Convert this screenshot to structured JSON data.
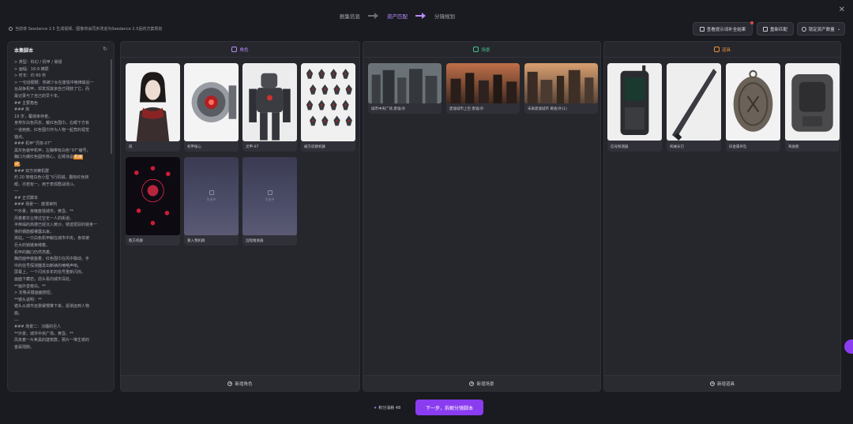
{
  "steps": [
    "剧集信息",
    "资产匹配",
    "分镜规划"
  ],
  "notice": "当前将 Seedance 2.5 生成视频，图像将会同步改进为Seedance 2.5后的方案规划",
  "toolbar": {
    "hint_btn": "查看提示词补全结果",
    "rematch_btn": "重新匹配",
    "lock_btn": "锁定资产数量"
  },
  "script_panel": {
    "title": "本集脚本",
    "lines": [
      "> 类型：科幻 / 机甲 / 悬疑",
      "> 画幅：16:9 横屏",
      "> 时长：约 60 秒",
      "> 一句话梗概：热被少女在废墟中晚律最后一",
      "台战争机甲，却发现其亲自己残骸了它，而",
      "最记录与了自己的早十年。",
      "## 主要角色",
      "### 岚",
      "19 岁，覆城幸存者。",
      "身穿灰白色风衣，戴红色围巾，右眼下方有",
      "一道疤痕。红色围巾作为人物一起竟的视觉",
      "锚点。",
      "### 机甲“灵核-07”",
      "黑灰色装甲机甲，左胸带有白色“07”编号，",
      "胸口为爆红色圆形核心，右臂液晶[机械]",
      "[武]。",
      "### 双方侦察机群",
      "约 20 架暗白色小型飞行机械，翻有红色核",
      "眼，亦若有一。用于表现群战场斗。",
      "---",
      "## 正式脚本",
      "### 场景一：废墟审判",
      "**外景，夜晚废墟城市，黄昏。**",
      "风卷着灰尘穿过空无一人的街道。",
      "半倒塌的高楼已经沉入黄沙，锈迹斑驳的镜身一",
      "排的钢筋都裸露出来。",
      "岚站，一只白色机甲躺在城市中央，身体被",
      "巨大的锁链束缚着。",
      "机甲的胸口仍然亮着。",
      "胸前面甲装盔着，红色围巾在风中飘动。手",
      "中的信号探测器发出断续的嘀嗒声响。",
      "屏幕上，一个闪烁多年的信号重新闪烁。",
      "画面下藏岩，前头看向城市深处。",
      "**画外音旁白。**",
      "> 定格关键画面按钮。",
      "**镜头说明：**",
      "镜头从城市远景缓慢推下来，逐渐远到人物",
      "面。",
      "---",
      "### 场景二：沉睡的巨人",
      "**外景，城市中央广场，黄昏。**",
      "风夹着一片焦黑的建筑群，那片一堆生锈的",
      "金属残骸。"
    ]
  },
  "columns": [
    {
      "label": "角色",
      "color": "#b98bff",
      "add_label": "新增角色",
      "cards": [
        {
          "caption": "岚",
          "kind": "girl"
        },
        {
          "caption": "机甲核心",
          "kind": "core"
        },
        {
          "caption": "灵甲-07",
          "kind": "mech"
        },
        {
          "caption": "被方侦察机群",
          "kind": "swarm"
        },
        {
          "caption": "敌方机群",
          "kind": "redswarm"
        },
        {
          "caption": "重入我机群",
          "kind": "placeholder",
          "ph": "生成中"
        },
        {
          "caption": "远程推进器",
          "kind": "placeholder",
          "ph": "生成中"
        }
      ]
    },
    {
      "label": "场景",
      "color": "#3fc38a",
      "add_label": "新增场景",
      "cards": [
        {
          "caption": "城市中央广场 废墟/外",
          "kind": "city1"
        },
        {
          "caption": "废墟城市上空 废墟/外",
          "kind": "city2"
        },
        {
          "caption": "未来废墟城市 黄昏/外(1)",
          "kind": "city3"
        }
      ]
    },
    {
      "label": "道具",
      "color": "#e8903a",
      "add_label": "新增道具",
      "cards": [
        {
          "caption": "信号探测器",
          "kind": "radio"
        },
        {
          "caption": "机械长刃",
          "kind": "blade"
        },
        {
          "caption": "旧金属吊坠",
          "kind": "pendant"
        },
        {
          "caption": "驾驶舱",
          "kind": "cockpit"
        }
      ]
    }
  ],
  "bottom": {
    "credits": "积分消耗 48",
    "next_btn": "下一步，拆解分镜脚本"
  }
}
